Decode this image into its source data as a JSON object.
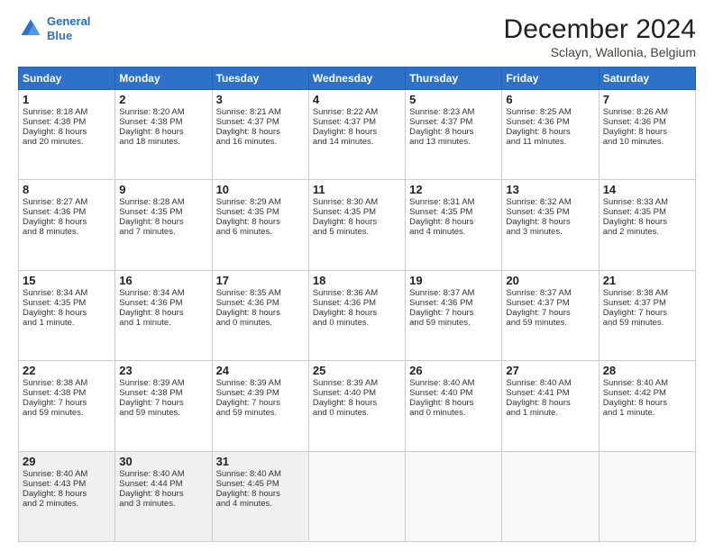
{
  "header": {
    "logo_line1": "General",
    "logo_line2": "Blue",
    "month": "December 2024",
    "location": "Sclayn, Wallonia, Belgium"
  },
  "weekdays": [
    "Sunday",
    "Monday",
    "Tuesday",
    "Wednesday",
    "Thursday",
    "Friday",
    "Saturday"
  ],
  "weeks": [
    [
      {
        "day": "1",
        "lines": [
          "Sunrise: 8:18 AM",
          "Sunset: 4:38 PM",
          "Daylight: 8 hours",
          "and 20 minutes."
        ]
      },
      {
        "day": "2",
        "lines": [
          "Sunrise: 8:20 AM",
          "Sunset: 4:38 PM",
          "Daylight: 8 hours",
          "and 18 minutes."
        ]
      },
      {
        "day": "3",
        "lines": [
          "Sunrise: 8:21 AM",
          "Sunset: 4:37 PM",
          "Daylight: 8 hours",
          "and 16 minutes."
        ]
      },
      {
        "day": "4",
        "lines": [
          "Sunrise: 8:22 AM",
          "Sunset: 4:37 PM",
          "Daylight: 8 hours",
          "and 14 minutes."
        ]
      },
      {
        "day": "5",
        "lines": [
          "Sunrise: 8:23 AM",
          "Sunset: 4:37 PM",
          "Daylight: 8 hours",
          "and 13 minutes."
        ]
      },
      {
        "day": "6",
        "lines": [
          "Sunrise: 8:25 AM",
          "Sunset: 4:36 PM",
          "Daylight: 8 hours",
          "and 11 minutes."
        ]
      },
      {
        "day": "7",
        "lines": [
          "Sunrise: 8:26 AM",
          "Sunset: 4:36 PM",
          "Daylight: 8 hours",
          "and 10 minutes."
        ]
      }
    ],
    [
      {
        "day": "8",
        "lines": [
          "Sunrise: 8:27 AM",
          "Sunset: 4:36 PM",
          "Daylight: 8 hours",
          "and 8 minutes."
        ]
      },
      {
        "day": "9",
        "lines": [
          "Sunrise: 8:28 AM",
          "Sunset: 4:35 PM",
          "Daylight: 8 hours",
          "and 7 minutes."
        ]
      },
      {
        "day": "10",
        "lines": [
          "Sunrise: 8:29 AM",
          "Sunset: 4:35 PM",
          "Daylight: 8 hours",
          "and 6 minutes."
        ]
      },
      {
        "day": "11",
        "lines": [
          "Sunrise: 8:30 AM",
          "Sunset: 4:35 PM",
          "Daylight: 8 hours",
          "and 5 minutes."
        ]
      },
      {
        "day": "12",
        "lines": [
          "Sunrise: 8:31 AM",
          "Sunset: 4:35 PM",
          "Daylight: 8 hours",
          "and 4 minutes."
        ]
      },
      {
        "day": "13",
        "lines": [
          "Sunrise: 8:32 AM",
          "Sunset: 4:35 PM",
          "Daylight: 8 hours",
          "and 3 minutes."
        ]
      },
      {
        "day": "14",
        "lines": [
          "Sunrise: 8:33 AM",
          "Sunset: 4:35 PM",
          "Daylight: 8 hours",
          "and 2 minutes."
        ]
      }
    ],
    [
      {
        "day": "15",
        "lines": [
          "Sunrise: 8:34 AM",
          "Sunset: 4:35 PM",
          "Daylight: 8 hours",
          "and 1 minute."
        ]
      },
      {
        "day": "16",
        "lines": [
          "Sunrise: 8:34 AM",
          "Sunset: 4:36 PM",
          "Daylight: 8 hours",
          "and 1 minute."
        ]
      },
      {
        "day": "17",
        "lines": [
          "Sunrise: 8:35 AM",
          "Sunset: 4:36 PM",
          "Daylight: 8 hours",
          "and 0 minutes."
        ]
      },
      {
        "day": "18",
        "lines": [
          "Sunrise: 8:36 AM",
          "Sunset: 4:36 PM",
          "Daylight: 8 hours",
          "and 0 minutes."
        ]
      },
      {
        "day": "19",
        "lines": [
          "Sunrise: 8:37 AM",
          "Sunset: 4:36 PM",
          "Daylight: 7 hours",
          "and 59 minutes."
        ]
      },
      {
        "day": "20",
        "lines": [
          "Sunrise: 8:37 AM",
          "Sunset: 4:37 PM",
          "Daylight: 7 hours",
          "and 59 minutes."
        ]
      },
      {
        "day": "21",
        "lines": [
          "Sunrise: 8:38 AM",
          "Sunset: 4:37 PM",
          "Daylight: 7 hours",
          "and 59 minutes."
        ]
      }
    ],
    [
      {
        "day": "22",
        "lines": [
          "Sunrise: 8:38 AM",
          "Sunset: 4:38 PM",
          "Daylight: 7 hours",
          "and 59 minutes."
        ]
      },
      {
        "day": "23",
        "lines": [
          "Sunrise: 8:39 AM",
          "Sunset: 4:38 PM",
          "Daylight: 7 hours",
          "and 59 minutes."
        ]
      },
      {
        "day": "24",
        "lines": [
          "Sunrise: 8:39 AM",
          "Sunset: 4:39 PM",
          "Daylight: 7 hours",
          "and 59 minutes."
        ]
      },
      {
        "day": "25",
        "lines": [
          "Sunrise: 8:39 AM",
          "Sunset: 4:40 PM",
          "Daylight: 8 hours",
          "and 0 minutes."
        ]
      },
      {
        "day": "26",
        "lines": [
          "Sunrise: 8:40 AM",
          "Sunset: 4:40 PM",
          "Daylight: 8 hours",
          "and 0 minutes."
        ]
      },
      {
        "day": "27",
        "lines": [
          "Sunrise: 8:40 AM",
          "Sunset: 4:41 PM",
          "Daylight: 8 hours",
          "and 1 minute."
        ]
      },
      {
        "day": "28",
        "lines": [
          "Sunrise: 8:40 AM",
          "Sunset: 4:42 PM",
          "Daylight: 8 hours",
          "and 1 minute."
        ]
      }
    ],
    [
      {
        "day": "29",
        "lines": [
          "Sunrise: 8:40 AM",
          "Sunset: 4:43 PM",
          "Daylight: 8 hours",
          "and 2 minutes."
        ]
      },
      {
        "day": "30",
        "lines": [
          "Sunrise: 8:40 AM",
          "Sunset: 4:44 PM",
          "Daylight: 8 hours",
          "and 3 minutes."
        ]
      },
      {
        "day": "31",
        "lines": [
          "Sunrise: 8:40 AM",
          "Sunset: 4:45 PM",
          "Daylight: 8 hours",
          "and 4 minutes."
        ]
      },
      null,
      null,
      null,
      null
    ]
  ]
}
